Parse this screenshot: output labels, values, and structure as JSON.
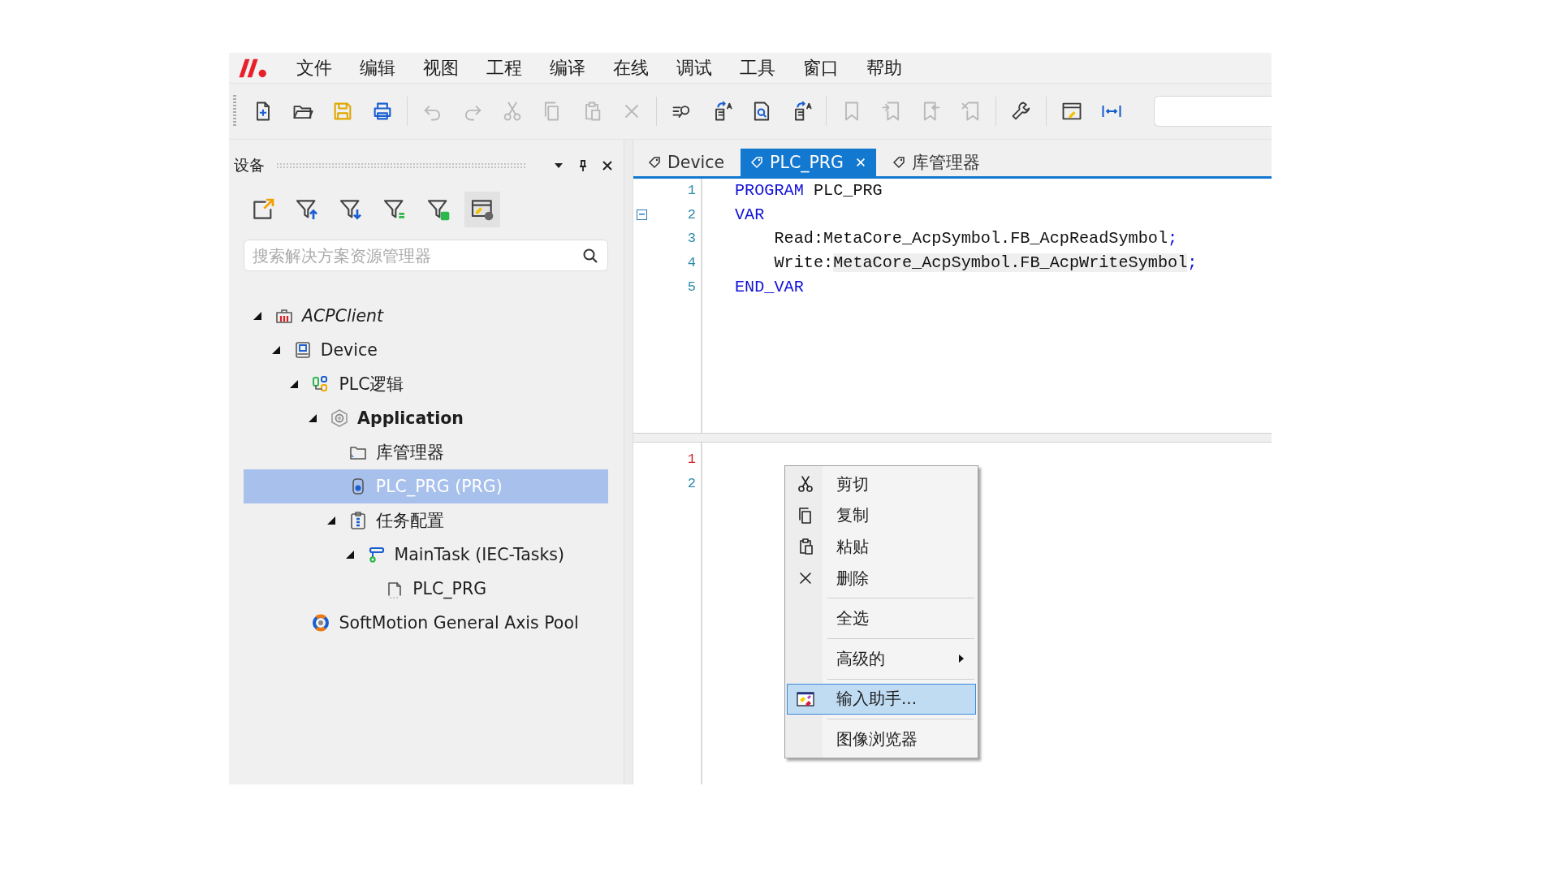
{
  "menu_bar": {
    "items": [
      "文件",
      "编辑",
      "视图",
      "工程",
      "编译",
      "在线",
      "调试",
      "工具",
      "窗口",
      "帮助"
    ]
  },
  "toolbar": [
    {
      "kind": "new",
      "disabled": false
    },
    {
      "kind": "open",
      "disabled": false
    },
    {
      "kind": "save",
      "disabled": false
    },
    {
      "kind": "print",
      "disabled": false
    },
    {
      "kind": "separator"
    },
    {
      "kind": "undo",
      "disabled": true
    },
    {
      "kind": "redo",
      "disabled": true
    },
    {
      "kind": "cut",
      "disabled": true
    },
    {
      "kind": "copy",
      "disabled": true
    },
    {
      "kind": "paste",
      "disabled": true
    },
    {
      "kind": "delete",
      "disabled": true
    },
    {
      "kind": "separator"
    },
    {
      "kind": "find",
      "disabled": false
    },
    {
      "kind": "doc-arrow",
      "disabled": false
    },
    {
      "kind": "doc-search",
      "disabled": false
    },
    {
      "kind": "doc-arrow",
      "disabled": false
    },
    {
      "kind": "separator"
    },
    {
      "kind": "bookmark",
      "disabled": true
    },
    {
      "kind": "bookmark-prev",
      "disabled": true
    },
    {
      "kind": "bookmark-next",
      "disabled": true
    },
    {
      "kind": "bookmark-clear",
      "disabled": true
    },
    {
      "kind": "separator"
    },
    {
      "kind": "wrench",
      "disabled": false
    },
    {
      "kind": "separator"
    },
    {
      "kind": "window",
      "disabled": false
    },
    {
      "kind": "resize",
      "disabled": false
    }
  ],
  "devices_panel": {
    "title": "设备",
    "tools": [
      {
        "kind": "export",
        "pressed": false
      },
      {
        "kind": "filter-up",
        "pressed": false
      },
      {
        "kind": "filter-down",
        "pressed": false
      },
      {
        "kind": "filter-list",
        "pressed": false
      },
      {
        "kind": "filter-grid",
        "pressed": false
      },
      {
        "kind": "window-settings",
        "pressed": true
      }
    ],
    "search": {
      "placeholder": "搜索解决方案资源管理器"
    },
    "tree": [
      {
        "label": "ACPClient",
        "kind": "project",
        "italic": true,
        "bold": false,
        "selected": false,
        "expanded": true,
        "children": [
          {
            "label": "Device",
            "kind": "device",
            "italic": false,
            "bold": false,
            "selected": false,
            "expanded": true,
            "children": [
              {
                "label": "PLC逻辑",
                "kind": "plc-logic",
                "italic": false,
                "bold": false,
                "selected": false,
                "expanded": true,
                "children": [
                  {
                    "label": "Application",
                    "kind": "application",
                    "italic": false,
                    "bold": true,
                    "selected": false,
                    "expanded": true,
                    "children": [
                      {
                        "label": "库管理器",
                        "kind": "folder",
                        "italic": false,
                        "bold": false,
                        "selected": false
                      },
                      {
                        "label": "PLC_PRG (PRG)",
                        "kind": "pou",
                        "italic": false,
                        "bold": false,
                        "selected": true
                      },
                      {
                        "label": "任务配置",
                        "kind": "task-config",
                        "italic": false,
                        "bold": false,
                        "selected": false,
                        "expanded": true,
                        "children": [
                          {
                            "label": "MainTask (IEC-Tasks)",
                            "kind": "task",
                            "italic": false,
                            "bold": false,
                            "selected": false,
                            "expanded": true,
                            "children": [
                              {
                                "label": "PLC_PRG",
                                "kind": "program-call",
                                "italic": false,
                                "bold": false,
                                "selected": false
                              }
                            ]
                          }
                        ]
                      }
                    ]
                  }
                ]
              },
              {
                "label": "SoftMotion General Axis Pool",
                "kind": "axis-pool",
                "italic": false,
                "bold": false,
                "selected": false
              }
            ]
          }
        ]
      }
    ]
  },
  "editor": {
    "tabs": [
      {
        "label": "Device",
        "selected": false
      },
      {
        "label": "PLC_PRG",
        "selected": true
      },
      {
        "label": "库管理器",
        "selected": false
      }
    ],
    "declaration": {
      "lines": [
        {
          "number": "1",
          "collapsible": false,
          "tokens": [
            {
              "text": "PROGRAM",
              "kind": "keyword"
            },
            {
              "text": " PLC_PRG",
              "kind": "plain"
            }
          ]
        },
        {
          "number": "2",
          "collapsible": true,
          "tokens": [
            {
              "text": "VAR",
              "kind": "keyword"
            }
          ]
        },
        {
          "number": "3",
          "collapsible": false,
          "tokens": [
            {
              "text": "    Read:MetaCore_AcpSymbol.FB_AcpReadSymbol",
              "kind": "plain"
            },
            {
              "text": ";",
              "kind": "keyword"
            }
          ]
        },
        {
          "number": "4",
          "collapsible": false,
          "tokens": [
            {
              "text": "    Write:",
              "kind": "plain"
            },
            {
              "text": "MetaCore_AcpSymbol.FB_AcpWriteSymbol",
              "kind": "highlight"
            },
            {
              "text": ";",
              "kind": "keyword"
            }
          ]
        },
        {
          "number": "5",
          "collapsible": false,
          "tokens": [
            {
              "text": "END_VAR",
              "kind": "keyword"
            }
          ]
        }
      ]
    },
    "body": {
      "lines": [
        {
          "number": "1",
          "current": true
        },
        {
          "number": "2",
          "current": false
        }
      ]
    }
  },
  "context_menu": {
    "items": [
      {
        "kind": "cut",
        "label": "剪切",
        "selected": false,
        "submenu": false
      },
      {
        "kind": "copy",
        "label": "复制",
        "selected": false,
        "submenu": false
      },
      {
        "kind": "paste",
        "label": "粘贴",
        "selected": false,
        "submenu": false
      },
      {
        "kind": "delete",
        "label": "删除",
        "selected": false,
        "submenu": false
      },
      {
        "kind": "separator"
      },
      {
        "kind": "select-all",
        "label": "全选",
        "selected": false,
        "submenu": false
      },
      {
        "kind": "separator"
      },
      {
        "kind": "advanced",
        "label": "高级的",
        "selected": false,
        "submenu": true
      },
      {
        "kind": "separator"
      },
      {
        "kind": "input-assistant",
        "label": "输入助手...",
        "selected": true,
        "submenu": false
      },
      {
        "kind": "separator"
      },
      {
        "kind": "image-browser",
        "label": "图像浏览器",
        "selected": false,
        "submenu": false
      }
    ]
  }
}
